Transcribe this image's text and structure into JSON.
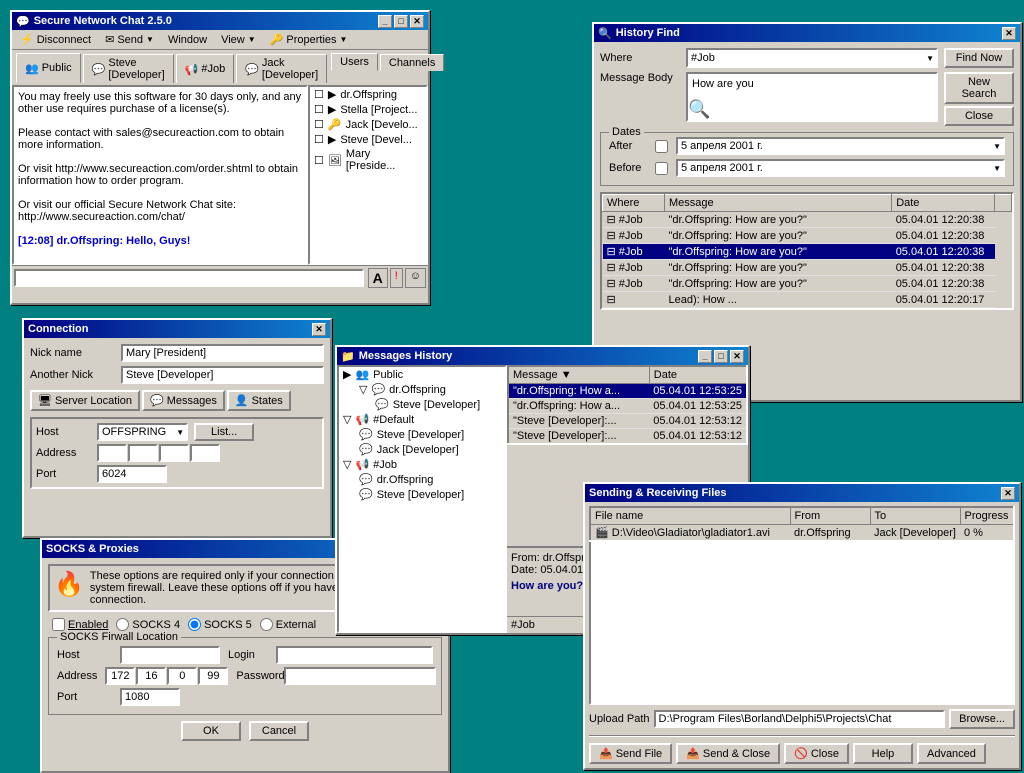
{
  "main_chat": {
    "title": "Secure Network Chat 2.5.0",
    "menu": {
      "items": [
        "Disconnect",
        "Send",
        "Window",
        "View",
        "Properties"
      ]
    },
    "tabs": [
      "Public",
      "Steve [Developer]",
      "#Job",
      "Jack [Developer]"
    ],
    "side_tabs": [
      "Users",
      "Channels"
    ],
    "chat_content": "You may freely use this software for 30 days only, and any other use requires purchase of a license(s).\n\nPlease contact with sales@secureaction.com to obtain more information.\n\nOr visit http://www.secureaction.com/order.shtml to obtain information how to order program.\n\nOr visit our official Secure Network Chat site:\nhttp://www.secureaction.com/chat/\n\n[12:08] dr.Offspring: Hello, Guys!",
    "users": [
      "dr.Offspring",
      "Stella [Project...",
      "Jack [Develo...",
      "Steve [Devel...",
      "Mary [Preside..."
    ]
  },
  "history_find": {
    "title": "History Find",
    "where_label": "Where",
    "where_value": "#Job",
    "message_body_label": "Message Body",
    "message_body_value": "How are you",
    "buttons": [
      "Find Now",
      "New Search",
      "Close"
    ],
    "dates": {
      "label": "Dates",
      "after_label": "After",
      "after_value": "5  апреля  2001 г.",
      "before_label": "Before",
      "before_value": "5  апреля  2001 г."
    },
    "columns": [
      "Where",
      "Message",
      "Date"
    ],
    "results": [
      {
        "where": "#Job",
        "message": "\"dr.Offspring: How are you?\"",
        "date": "05.04.01 12:20:38"
      },
      {
        "where": "#Job",
        "message": "\"dr.Offspring: How are you?\"",
        "date": "05.04.01 12:20:38"
      },
      {
        "where": "#Job",
        "message": "\"dr.Offspring: How are you?\"",
        "date": "05.04.01 12:20:38",
        "selected": true
      },
      {
        "where": "#Job",
        "message": "\"dr.Offspring: How are you?\"",
        "date": "05.04.01 12:20:38"
      },
      {
        "where": "#Job",
        "message": "\"dr.Offspring: How are you?\"",
        "date": "05.04.01 12:20:38"
      },
      {
        "where": "",
        "message": "Lead): How ...",
        "date": "05.04.01 12:20:17"
      }
    ]
  },
  "connection": {
    "title": "Connection",
    "nick_name_label": "Nick name",
    "nick_name_value": "Mary [President]",
    "another_nick_label": "Another Nick",
    "another_nick_value": "Steve [Developer]",
    "tabs": [
      "Server Location",
      "Messages",
      "States"
    ],
    "host_label": "Host",
    "host_value": "OFFSPRING",
    "address_label": "Address",
    "port_label": "Port",
    "port_value": "6024",
    "list_btn": "List..."
  },
  "socks_proxies": {
    "title": "SOCKS & Proxies",
    "description": "These options are required only if your connection must run though a system firewall. Leave these options off if you have a direct internet connection.",
    "enabled_label": "Enabled",
    "socks4_label": "SOCKS 4",
    "socks5_label": "SOCKS 5",
    "external_label": "External",
    "firewall_label": "SOCKS Firwall Location",
    "host_label": "Host",
    "address_label": "Address",
    "address_value": "172.16.0.99",
    "port_label": "Port",
    "port_value": "1080",
    "login_label": "Login",
    "password_label": "Password",
    "buttons": [
      "OK",
      "Cancel"
    ]
  },
  "messages_history": {
    "title": "Messages History",
    "tree": [
      {
        "label": "Public",
        "children": [
          {
            "label": "dr.Offspring",
            "children": [
              {
                "label": "Steve [Developer]"
              }
            ]
          }
        ]
      },
      {
        "label": "#Default",
        "children": [
          {
            "label": "Steve [Developer]"
          },
          {
            "label": "Jack [Developer]"
          }
        ]
      },
      {
        "label": "#Job",
        "children": [
          {
            "label": "dr.Offspring"
          },
          {
            "label": "Steve [Developer]"
          }
        ]
      }
    ],
    "message_columns": [
      "Message",
      "Date"
    ],
    "messages": [
      {
        "message": "\"dr.Offspring: How a...",
        "date": "05.04.01 12:53:25",
        "selected": true
      },
      {
        "message": "\"dr.Offspring: How a...",
        "date": "05.04.01 12:53:25"
      },
      {
        "message": "\"Steve [Developer]:...",
        "date": "05.04.01 12:53:12"
      },
      {
        "message": "\"Steve [Developer]:...",
        "date": "05.04.01 12:53:12"
      }
    ],
    "from_label": "From:",
    "from_value": "dr.Offsprir",
    "date_label": "Date:",
    "date_value": "05.04.01",
    "message_preview": "How are you?"
  },
  "sending_files": {
    "title": "Sending & Receiving Files",
    "columns": [
      "File name",
      "From",
      "To",
      "Progress"
    ],
    "files": [
      {
        "name": "D:\\Video\\Gladiator\\gladiator1.avi",
        "from": "dr.Offspring",
        "to": "Jack [Developer]",
        "progress": "0 %"
      }
    ],
    "upload_path_label": "Upload Path",
    "upload_path_value": "D:\\Program Files\\Borland\\Delphi5\\Projects\\Chat",
    "browse_btn": "Browse...",
    "buttons": [
      "Send File",
      "Send & Close",
      "Close",
      "Help",
      "Advanced"
    ]
  }
}
